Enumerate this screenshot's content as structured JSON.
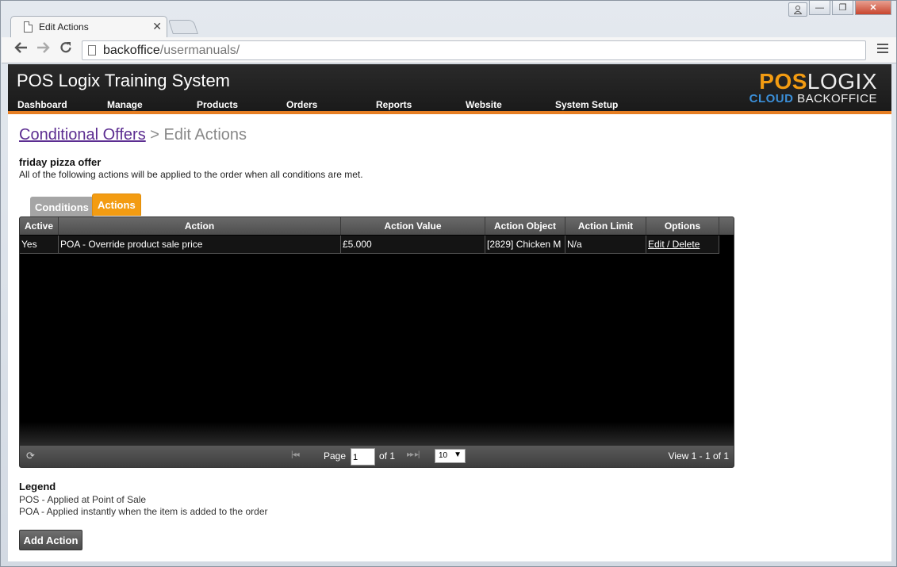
{
  "browser": {
    "tab_title": "Edit Actions",
    "tab_close": "✕",
    "url_host": "backoffice",
    "url_path": "/usermanuals/",
    "win_minimize": "—",
    "win_restore": "❐",
    "win_close": "✕"
  },
  "header": {
    "title": "POS Logix Training System",
    "logo_pos": "POS",
    "logo_logix": "LOGIX",
    "logo_cloud": "CLOUD",
    "logo_backoffice": "BACKOFFICE",
    "nav": [
      "Dashboard",
      "Manage",
      "Products",
      "Orders",
      "Reports",
      "Website",
      "System Setup"
    ]
  },
  "breadcrumb": {
    "parent": "Conditional Offers",
    "separator": " > ",
    "current": "Edit Actions"
  },
  "offer": {
    "name": "friday pizza offer",
    "description": "All of the following actions will be applied to the order when all conditions are met."
  },
  "tabs": {
    "conditions": "Conditions",
    "actions": "Actions"
  },
  "grid": {
    "columns": [
      "Active",
      "Action",
      "Action Value",
      "Action Object",
      "Action Limit",
      "Options"
    ],
    "rows": [
      {
        "active": "Yes",
        "action": "POA - Override product sale price",
        "value": "£5.000",
        "object": "[2829] Chicken M",
        "limit": "N/a",
        "options": "Edit / Delete"
      }
    ],
    "pager": {
      "page_label": "Page",
      "page_value": "1",
      "of_label": "of 1",
      "rows_per_page": "10",
      "view_info": "View 1 - 1 of 1"
    }
  },
  "legend": {
    "title": "Legend",
    "items": [
      "POS - Applied at Point of Sale",
      "POA - Applied instantly when the item is added to the order"
    ]
  },
  "add_button": "Add Action",
  "colors": {
    "accent": "#f39c12",
    "header_bg": "#1a1a1a",
    "link": "#5c2d91"
  }
}
